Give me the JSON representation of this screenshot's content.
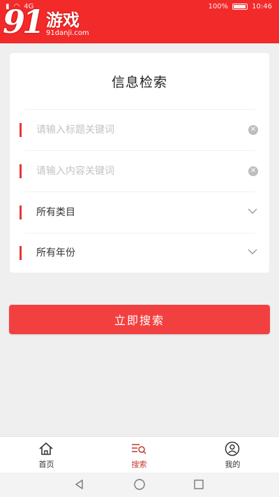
{
  "status_bar": {
    "left_text": "4G",
    "battery": "100%",
    "time": "10:46"
  },
  "watermark": {
    "number": "91",
    "name": "游戏",
    "url": "91danji.com"
  },
  "card": {
    "title": "信息检索",
    "title_keyword_placeholder": "请输入标题关键词",
    "content_keyword_placeholder": "请输入内容关键词",
    "category_select": "所有类目",
    "year_select": "所有年份"
  },
  "search_button": "立即搜索",
  "tabs": [
    {
      "label": "首页",
      "icon": "home-icon",
      "active": false
    },
    {
      "label": "搜索",
      "icon": "search-list-icon",
      "active": true
    },
    {
      "label": "我的",
      "icon": "user-icon",
      "active": false
    }
  ],
  "colors": {
    "header": "#f22a2a",
    "accent": "#e53535",
    "button": "#f24040",
    "active_tab": "#c0392b"
  }
}
